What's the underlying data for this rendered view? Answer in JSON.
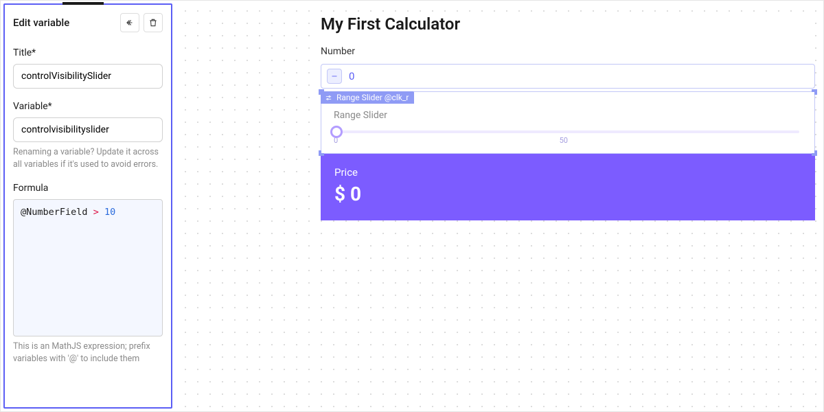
{
  "panel": {
    "title": "Edit variable",
    "fields": {
      "title_label": "Title*",
      "title_value": "controlVisibilitySlider",
      "variable_label": "Variable*",
      "variable_value": "controlvisibilityslider",
      "variable_help": "Renaming a variable? Update it across all variables if it's used to avoid errors.",
      "formula_label": "Formula",
      "formula_parts": {
        "ref": "@NumberField",
        "op": ">",
        "num": "10"
      },
      "formula_help": "This is an MathJS expression; prefix variables with '@' to include them"
    }
  },
  "calculator": {
    "title": "My First Calculator",
    "number": {
      "label": "Number",
      "value": "0"
    },
    "slider": {
      "tag": "Range Slider @clk_r",
      "label": "Range Slider",
      "min": "0",
      "mid": "50"
    },
    "price": {
      "label": "Price",
      "value": "$ 0"
    }
  },
  "colors": {
    "accent": "#7c5cff",
    "selection": "#5b5ef5"
  }
}
